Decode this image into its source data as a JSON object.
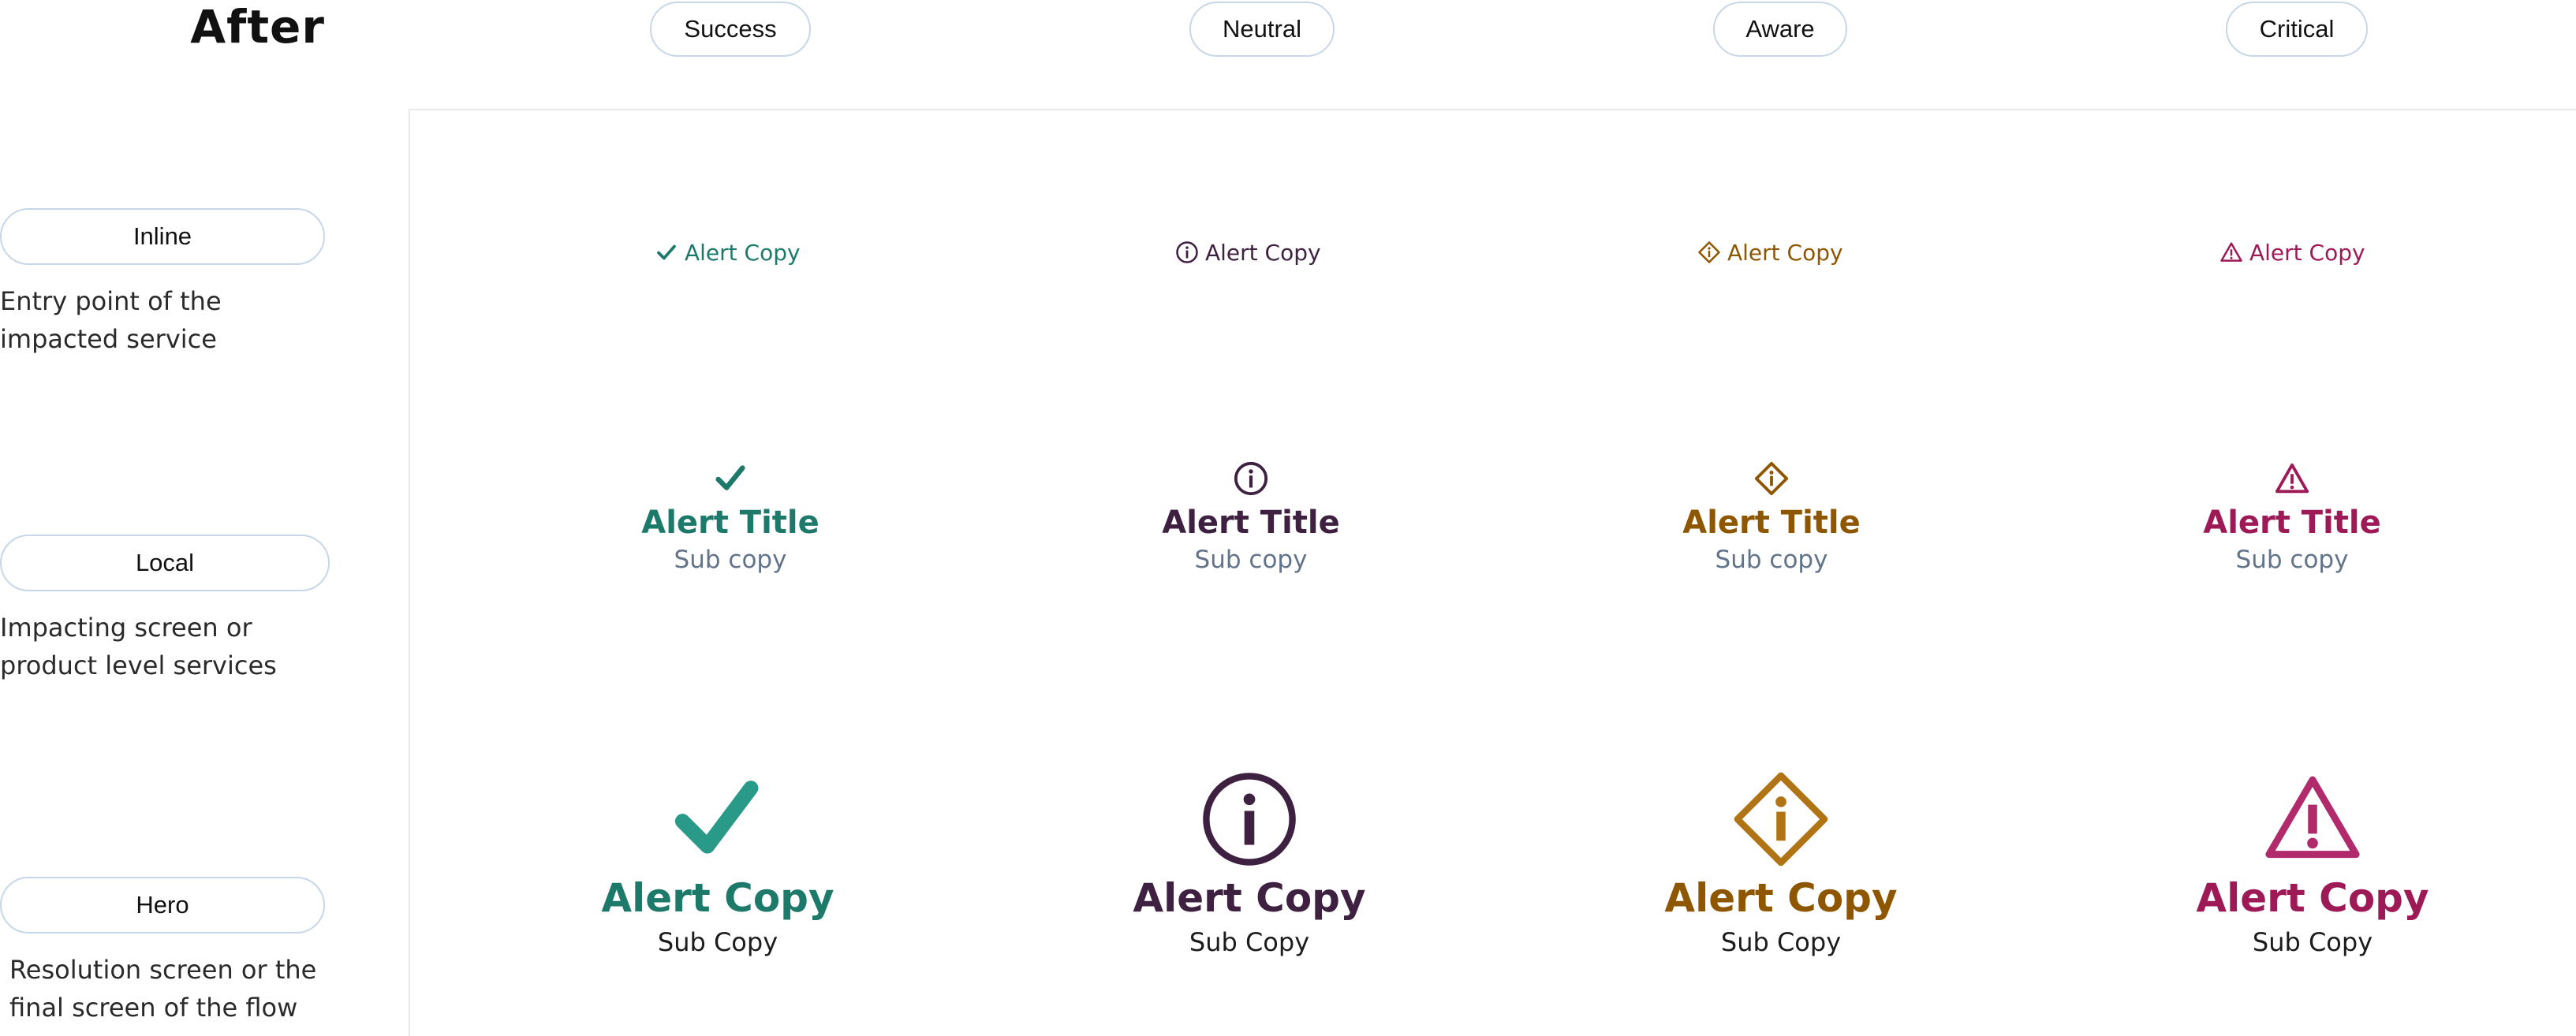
{
  "page": {
    "title": "After"
  },
  "columns": [
    {
      "key": "success",
      "label": "Success",
      "color": "#1d7a6b"
    },
    {
      "key": "neutral",
      "label": "Neutral",
      "color": "#3e2140"
    },
    {
      "key": "aware",
      "label": "Aware",
      "color": "#8f5600"
    },
    {
      "key": "critical",
      "label": "Critical",
      "color": "#9e1a57"
    }
  ],
  "rows": [
    {
      "label": "Inline",
      "description": "Entry point of the impacted service"
    },
    {
      "label": "Local",
      "description": "Impacting screen or product level services"
    },
    {
      "label": "Hero",
      "description": "Resolution screen or the final screen of the flow"
    }
  ],
  "inline": {
    "success": {
      "text": "Alert Copy",
      "icon": "checkmark-icon"
    },
    "neutral": {
      "text": "Alert Copy",
      "icon": "info-circle-icon"
    },
    "aware": {
      "text": "Alert Copy",
      "icon": "info-diamond-icon"
    },
    "critical": {
      "text": "Alert Copy",
      "icon": "warning-triangle-icon"
    }
  },
  "local": {
    "success": {
      "title": "Alert Title",
      "sub": "Sub copy",
      "icon": "checkmark-icon"
    },
    "neutral": {
      "title": "Alert Title",
      "sub": "Sub copy",
      "icon": "info-circle-icon"
    },
    "aware": {
      "title": "Alert Title",
      "sub": "Sub copy",
      "icon": "info-diamond-icon"
    },
    "critical": {
      "title": "Alert Title",
      "sub": "Sub copy",
      "icon": "warning-triangle-icon"
    }
  },
  "hero": {
    "success": {
      "title": "Alert Copy",
      "sub": "Sub Copy",
      "icon": "checkmark-icon"
    },
    "neutral": {
      "title": "Alert Copy",
      "sub": "Sub Copy",
      "icon": "info-circle-icon"
    },
    "aware": {
      "title": "Alert Copy",
      "sub": "Sub Copy",
      "icon": "info-diamond-icon"
    },
    "critical": {
      "title": "Alert Copy",
      "sub": "Sub Copy",
      "icon": "warning-triangle-icon"
    }
  }
}
